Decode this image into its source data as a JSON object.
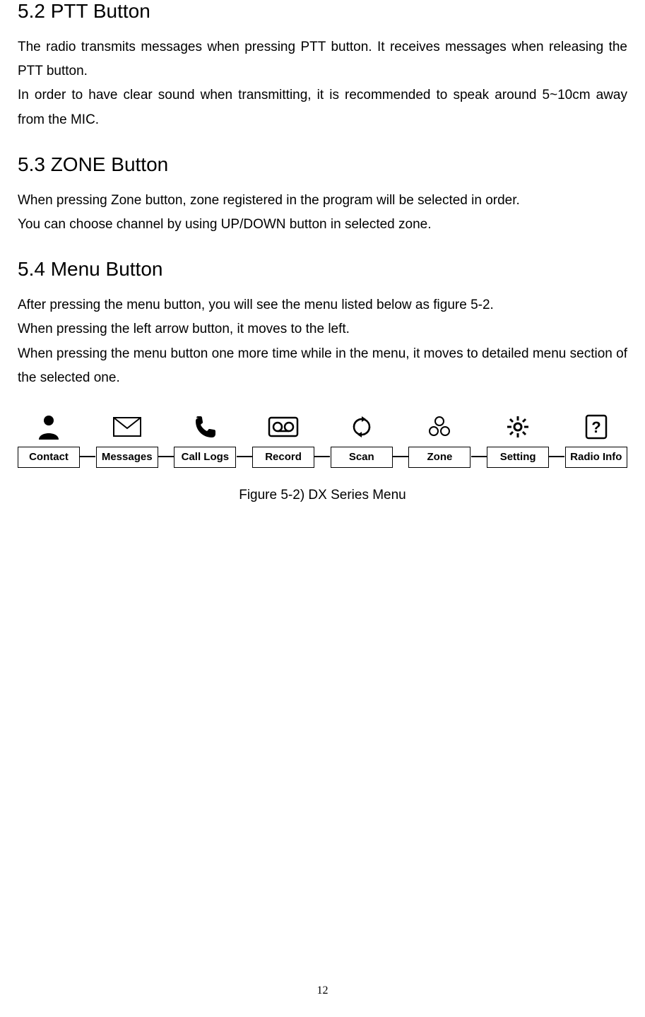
{
  "sections": {
    "s52": {
      "heading": "5.2 PTT Button",
      "body": "The radio transmits messages when pressing PTT button. It receives messages when releasing the PTT button.\nIn order to have clear sound when transmitting, it is recommended to speak around 5~10cm away from the MIC."
    },
    "s53": {
      "heading": "5.3 ZONE Button",
      "body": "When pressing Zone button, zone registered in the program will be selected in order.\nYou can choose channel by using UP/DOWN button in selected zone."
    },
    "s54": {
      "heading": "5.4 Menu Button",
      "body": "After pressing the menu button, you will see the menu listed below as figure 5-2.\nWhen pressing the left arrow button, it moves to the left.\nWhen pressing the menu button one more time while in the menu, it moves to detailed menu section of the selected one."
    }
  },
  "menu": {
    "items": [
      {
        "label": "Contact"
      },
      {
        "label": "Messages"
      },
      {
        "label": "Call Logs"
      },
      {
        "label": "Record"
      },
      {
        "label": "Scan"
      },
      {
        "label": "Zone"
      },
      {
        "label": "Setting"
      },
      {
        "label": "Radio Info"
      }
    ]
  },
  "figure_caption": "Figure 5-2) DX Series Menu",
  "page_number": "12"
}
